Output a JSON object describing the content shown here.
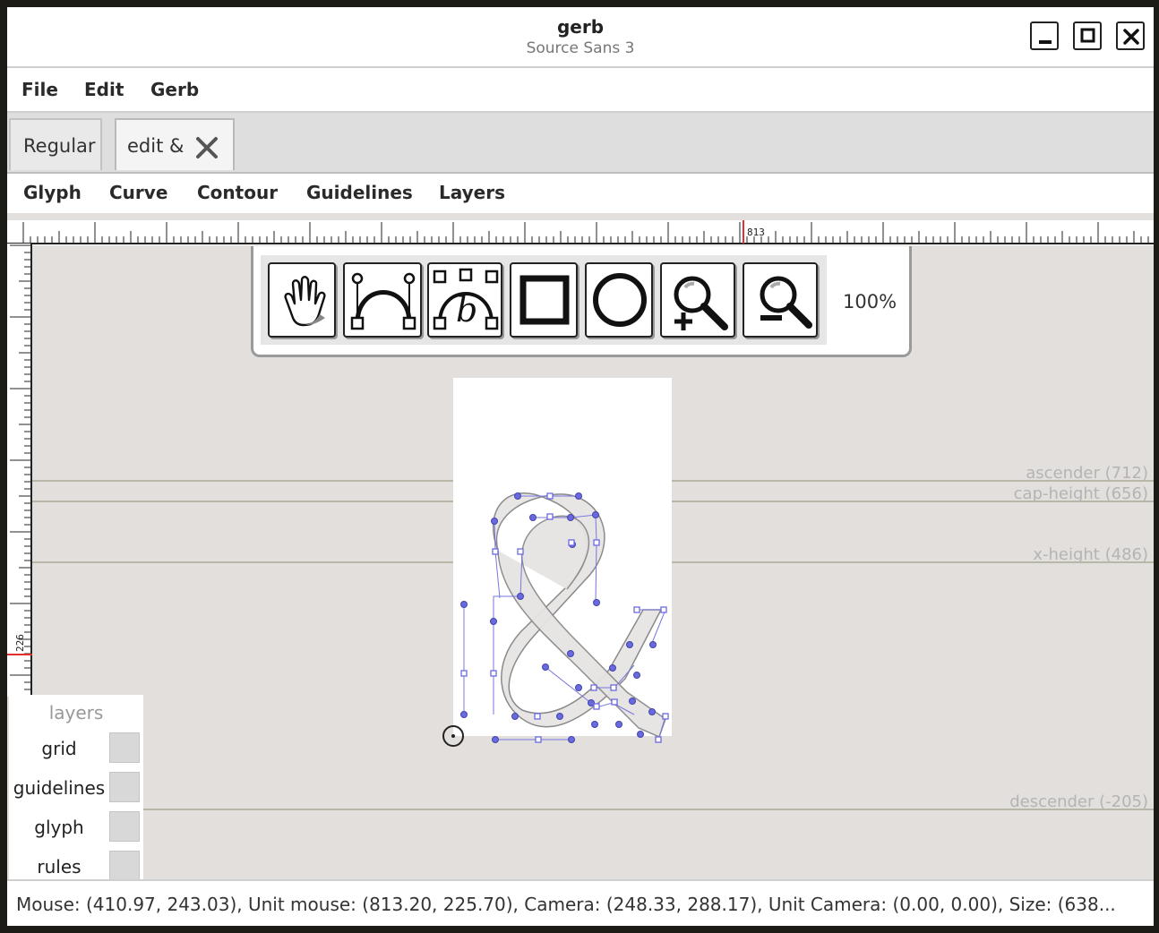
{
  "window": {
    "title": "gerb",
    "subtitle": "Source Sans 3",
    "controls": [
      "minimize-icon",
      "maximize-icon",
      "close-icon"
    ]
  },
  "menubar": {
    "items": [
      "File",
      "Edit",
      "Gerb"
    ]
  },
  "tabs": [
    {
      "label": "Regular",
      "closable": false
    },
    {
      "label": "edit &",
      "closable": true,
      "close_icon": "close-x-icon"
    }
  ],
  "tool_menu": {
    "items": [
      "Glyph",
      "Curve",
      "Contour",
      "Guidelines",
      "Layers"
    ]
  },
  "rulers": {
    "horizontal_marker": "813",
    "vertical_marker": "226",
    "marker_color": "#e03030"
  },
  "toolbox": {
    "tools": [
      {
        "name": "pan",
        "icon": "hand-icon"
      },
      {
        "name": "bezier",
        "icon": "bezier-curve-icon"
      },
      {
        "name": "b-spline",
        "icon": "bspline-curve-icon"
      },
      {
        "name": "rectangle",
        "icon": "rectangle-icon"
      },
      {
        "name": "ellipse",
        "icon": "ellipse-icon"
      },
      {
        "name": "zoom in",
        "icon": "zoom-in-icon"
      },
      {
        "name": "zoom out",
        "icon": "zoom-out-icon"
      }
    ],
    "zoom": "100%"
  },
  "guidelines": [
    {
      "label": "ascender (712)"
    },
    {
      "label": "cap-height (656)"
    },
    {
      "label": "x-height (486)"
    },
    {
      "label": "descender (-205)"
    }
  ],
  "glyph": {
    "character": "&",
    "fill": "#e8e5e5",
    "point_color": "#6a6ae0"
  },
  "layers": {
    "title": "layers",
    "items": [
      "grid",
      "guidelines",
      "glyph",
      "rules"
    ]
  },
  "status": "Mouse: (410.97, 243.03), Unit mouse: (813.20, 225.70), Camera: (248.33, 288.17), Unit Camera: (0.00, 0.00), Size: (638..."
}
